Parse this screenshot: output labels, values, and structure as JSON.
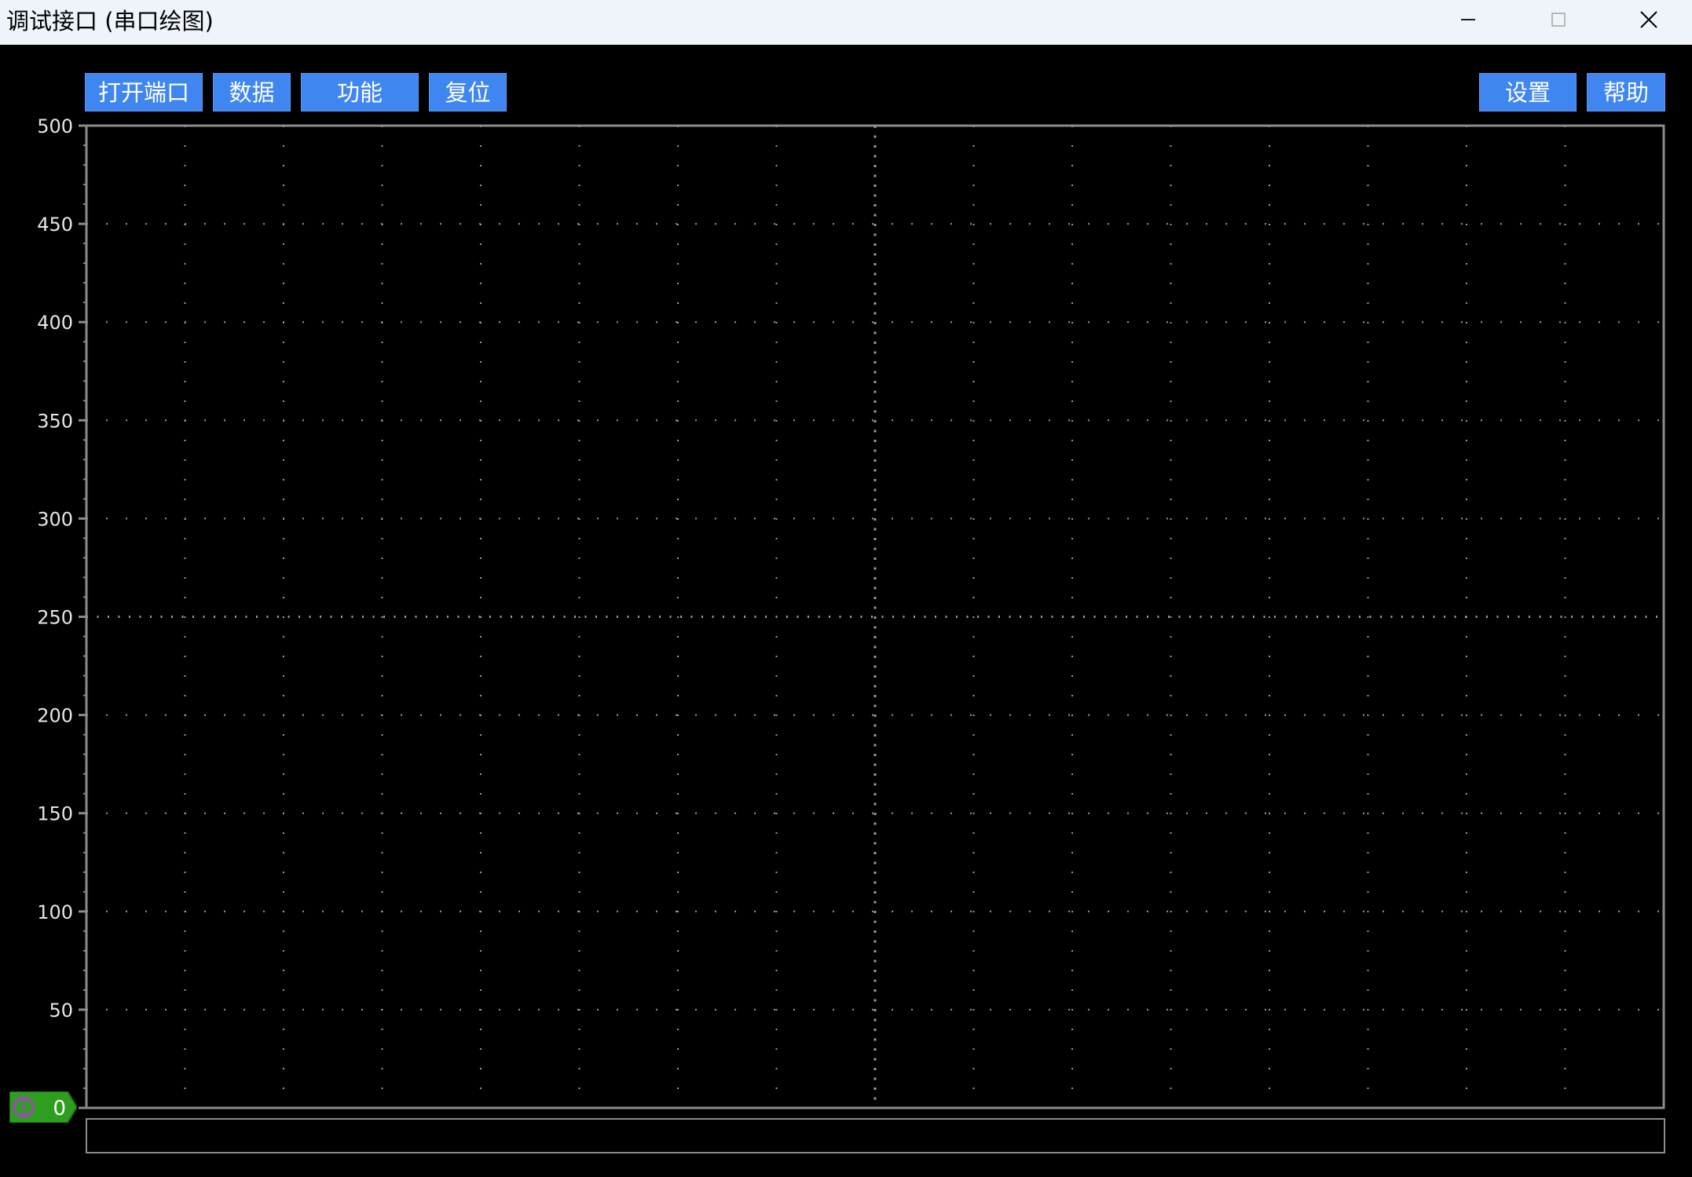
{
  "window": {
    "title": "调试接口 (串口绘图)",
    "icons": [
      "minimize-icon",
      "maximize-icon",
      "close-icon"
    ]
  },
  "toolbar": {
    "open_port_label": "打开端口",
    "data_label": "数据",
    "function_label": "功能",
    "reset_label": "复位",
    "settings_label": "设置",
    "help_label": "帮助",
    "button_color": "#3f86f0"
  },
  "channel": {
    "marker_value": "0",
    "marker_color": "#2e9e1e",
    "marker_icon": "channel-indicator-icon"
  },
  "status": {
    "text": ""
  },
  "chart_data": {
    "type": "line",
    "title": "",
    "xlabel": "",
    "ylabel": "",
    "ylim": [
      0,
      500
    ],
    "y_ticks": [
      0,
      50,
      100,
      150,
      200,
      250,
      300,
      350,
      400,
      450,
      500
    ],
    "y_tick_labels": [
      "0",
      "50",
      "100",
      "150",
      "200",
      "250",
      "300",
      "350",
      "400",
      "450",
      "500"
    ],
    "x_divisions": 16,
    "grid": true,
    "series": [],
    "colors": {
      "background": "#000000",
      "axis": "#8c8c8c",
      "grid": "#9a9a9a",
      "tick_label": "#e6e6e6"
    }
  }
}
